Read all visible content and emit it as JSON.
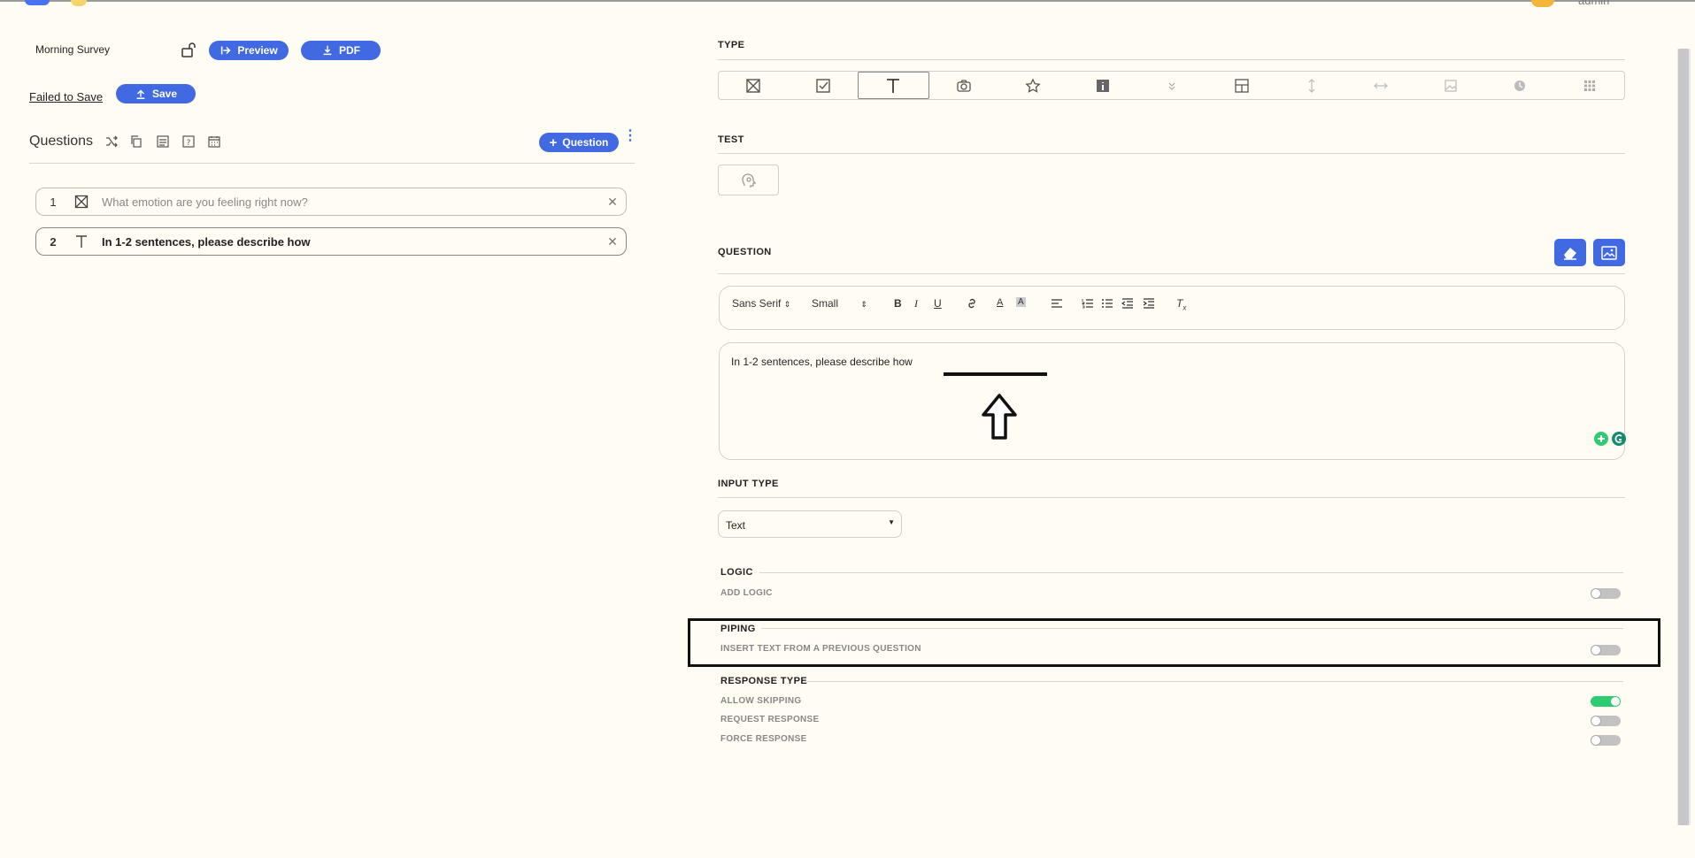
{
  "header": {
    "user_name": "admin"
  },
  "survey": {
    "name": "Morning Survey",
    "preview_label": "Preview",
    "pdf_label": "PDF",
    "save_status": "Failed to Save",
    "save_label": "Save"
  },
  "questions_panel": {
    "title": "Questions",
    "add_label": "Question",
    "items": [
      {
        "number": "1",
        "type_icon": "multiple-choice-icon",
        "text": "What emotion are you feeling right now?"
      },
      {
        "number": "2",
        "type_icon": "text-type-icon",
        "text": "In 1-2 sentences, please describe how"
      }
    ]
  },
  "editor_panel": {
    "type_label": "TYPE",
    "type_icons": [
      "multiple-choice-icon",
      "checkbox-icon",
      "text-type-icon",
      "camera-icon",
      "star-icon",
      "info-icon",
      "chevron-down-icon",
      "layout-icon",
      "vertical-arrow-icon",
      "horizontal-arrow-icon",
      "image-icon",
      "clock-icon",
      "grid-icon"
    ],
    "selected_type": "text-type-icon",
    "test_label": "TEST",
    "question_label": "QUESTION",
    "toolbar": {
      "font": "Sans Serif",
      "size": "Small"
    },
    "question_text": "In 1-2 sentences, please describe how",
    "input_type_label": "INPUT TYPE",
    "input_type_value": "Text",
    "logic": {
      "title": "LOGIC",
      "add_logic": "ADD LOGIC",
      "add_logic_on": false
    },
    "piping": {
      "title": "PIPING",
      "insert_text": "INSERT TEXT FROM A PREVIOUS QUESTION",
      "insert_on": false
    },
    "response_type": {
      "title": "RESPONSE TYPE",
      "options": [
        {
          "label": "ALLOW SKIPPING",
          "on": true
        },
        {
          "label": "REQUEST RESPONSE",
          "on": false
        },
        {
          "label": "FORCE RESPONSE",
          "on": false
        }
      ]
    }
  },
  "colors": {
    "accent": "#4169e1",
    "background": "#fffcf3",
    "toggle_on": "#2ecc71"
  }
}
